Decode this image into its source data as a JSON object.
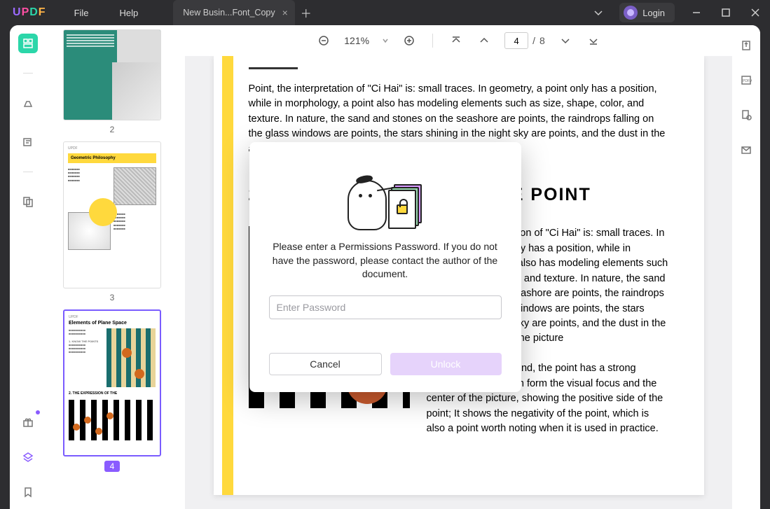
{
  "titlebar": {
    "menu_file": "File",
    "menu_help": "Help",
    "tab_title": "New Busin...Font_Copy",
    "login_label": "Login"
  },
  "toolbar": {
    "zoom_text": "121%",
    "page_current": "4",
    "page_sep": "/",
    "page_total": "8"
  },
  "thumbs": {
    "p2_label": "2",
    "p3_label": "3",
    "p4_label": "4",
    "t3_heading": "Geometric Philosophy",
    "t4_heading": "Elements of Plane Space",
    "t4_sub1": "1. KNOW THE POINTS",
    "t4_sub2": "2. THE EXPRESSION OF THE"
  },
  "doc": {
    "para1": "Point, the interpretation of \"Ci Hai\" is: small traces. In geometry, a point only has a position, while in morphology, a point also has modeling elements such as size, shape, color, and texture. In nature, the sand and stones on the seashore are points, the raindrops falling on the glass windows are points, the stars shining in the night sky are points, and the dust in the air is also points.",
    "heading": "2. THE EXPRESSION OF THE POINT",
    "para2a": "Point, the interpretation of \"Ci Hai\" is: small traces. In geometry, a point only has a position, while in morphology, a point also has modeling elements such as size, shape, color, and texture. In nature, the sand and stones on the seashore are points, the raindrops falling on the glass windows are points, the stars shining in the night sky are points, and the dust in the air is also points. In the picture",
    "para2b": "space, on the one hand, the point has a strong centripetal, which can form the visual focus and the center of the picture, showing the positive side of the point; It shows the negativity of the point, which is also a point worth noting when it is used in practice."
  },
  "modal": {
    "message": "Please enter a Permissions Password. If you do not have the password, please contact the author of the document.",
    "placeholder": "Enter Password",
    "cancel": "Cancel",
    "unlock": "Unlock"
  }
}
